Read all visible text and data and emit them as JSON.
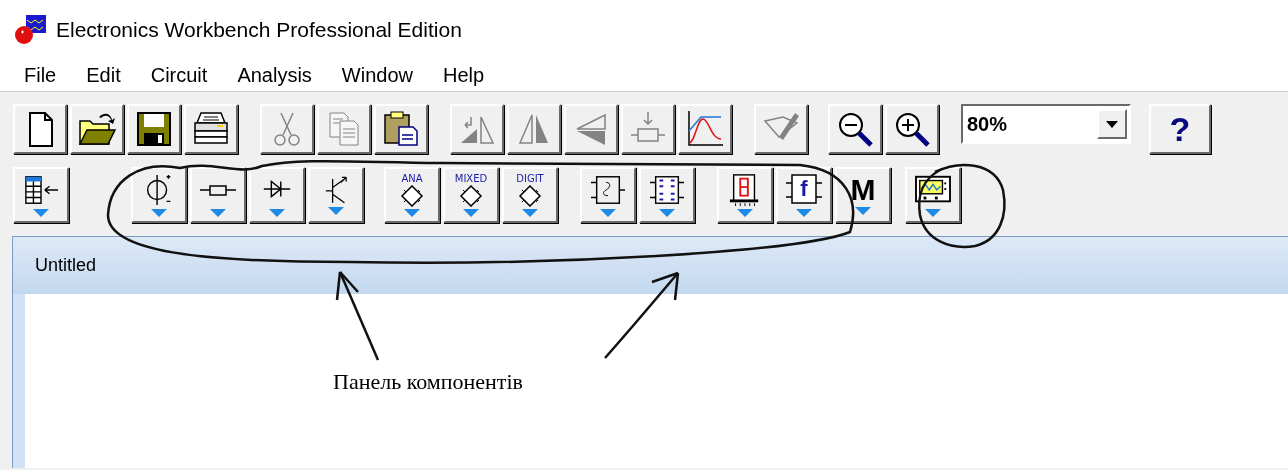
{
  "window": {
    "title": "Electronics Workbench Professional Edition"
  },
  "menu": [
    "File",
    "Edit",
    "Circuit",
    "Analysis",
    "Window",
    "Help"
  ],
  "toolbar": {
    "groups": [
      [
        {
          "kind": "new",
          "disabled": false
        },
        {
          "kind": "open",
          "disabled": false
        },
        {
          "kind": "save",
          "disabled": false
        },
        {
          "kind": "print",
          "disabled": false
        }
      ],
      [
        {
          "kind": "cut",
          "disabled": true
        },
        {
          "kind": "copy",
          "disabled": true
        },
        {
          "kind": "paste",
          "disabled": false
        }
      ],
      [
        {
          "kind": "rotate",
          "disabled": true
        },
        {
          "kind": "flip-h",
          "disabled": true
        },
        {
          "kind": "flip-v",
          "disabled": true
        },
        {
          "kind": "subcircuit",
          "disabled": true
        },
        {
          "kind": "graph",
          "disabled": false
        }
      ],
      [
        {
          "kind": "description",
          "disabled": true
        }
      ],
      [
        {
          "kind": "zoom-out",
          "disabled": false
        },
        {
          "kind": "zoom-in",
          "disabled": false
        }
      ]
    ],
    "zoom": {
      "value": "80%"
    },
    "help": {
      "label": "?"
    }
  },
  "parts_bar": {
    "groups": [
      [
        {
          "kind": "parts-bin"
        }
      ],
      [
        {
          "kind": "source"
        },
        {
          "kind": "resistor"
        },
        {
          "kind": "diode"
        },
        {
          "kind": "transistor"
        }
      ],
      [
        {
          "kind": "chip",
          "label": "ANA"
        },
        {
          "kind": "chip",
          "label": "MIXED"
        },
        {
          "kind": "chip",
          "label": "DIGIT"
        }
      ],
      [
        {
          "kind": "gate"
        },
        {
          "kind": "flipflop"
        }
      ],
      [
        {
          "kind": "display"
        },
        {
          "kind": "control",
          "label": "f"
        },
        {
          "kind": "misc",
          "label": "M"
        }
      ],
      [
        {
          "kind": "instrument"
        }
      ]
    ]
  },
  "document": {
    "title": "Untitled"
  },
  "annotation": {
    "text": "Панель компонентів"
  }
}
